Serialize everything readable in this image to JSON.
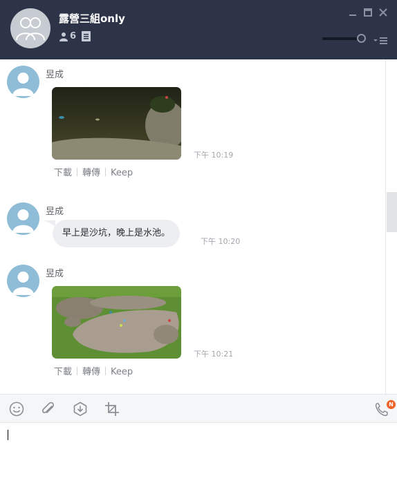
{
  "header": {
    "group_name": "露營三組only",
    "member_count": "6",
    "icons": [
      "group-avatar-icon",
      "member-icon",
      "notes-icon",
      "minimize-icon",
      "maximize-icon",
      "close-icon",
      "menu-icon"
    ],
    "volume_level": 0.85
  },
  "messages": [
    {
      "sender": "昱成",
      "type": "image",
      "time": "下午 10:19",
      "actions": [
        "下載",
        "轉傳",
        "Keep"
      ]
    },
    {
      "sender": "昱成",
      "type": "text",
      "text": "早上是沙坑，晚上是水池。",
      "time": "下午 10:20"
    },
    {
      "sender": "昱成",
      "type": "image",
      "time": "下午 10:21",
      "actions": [
        "下載",
        "轉傳",
        "Keep"
      ]
    }
  ],
  "toolbar": {
    "icons": [
      "emoji-icon",
      "attach-icon",
      "keep-icon",
      "crop-icon",
      "call-icon"
    ],
    "call_badge": "N"
  },
  "input": {
    "value": "",
    "placeholder": ""
  },
  "colors": {
    "header_bg": "#2d3448",
    "avatar_bg": "#8fbdd8",
    "bubble_bg": "#eceef1",
    "badge": "#f06227"
  }
}
